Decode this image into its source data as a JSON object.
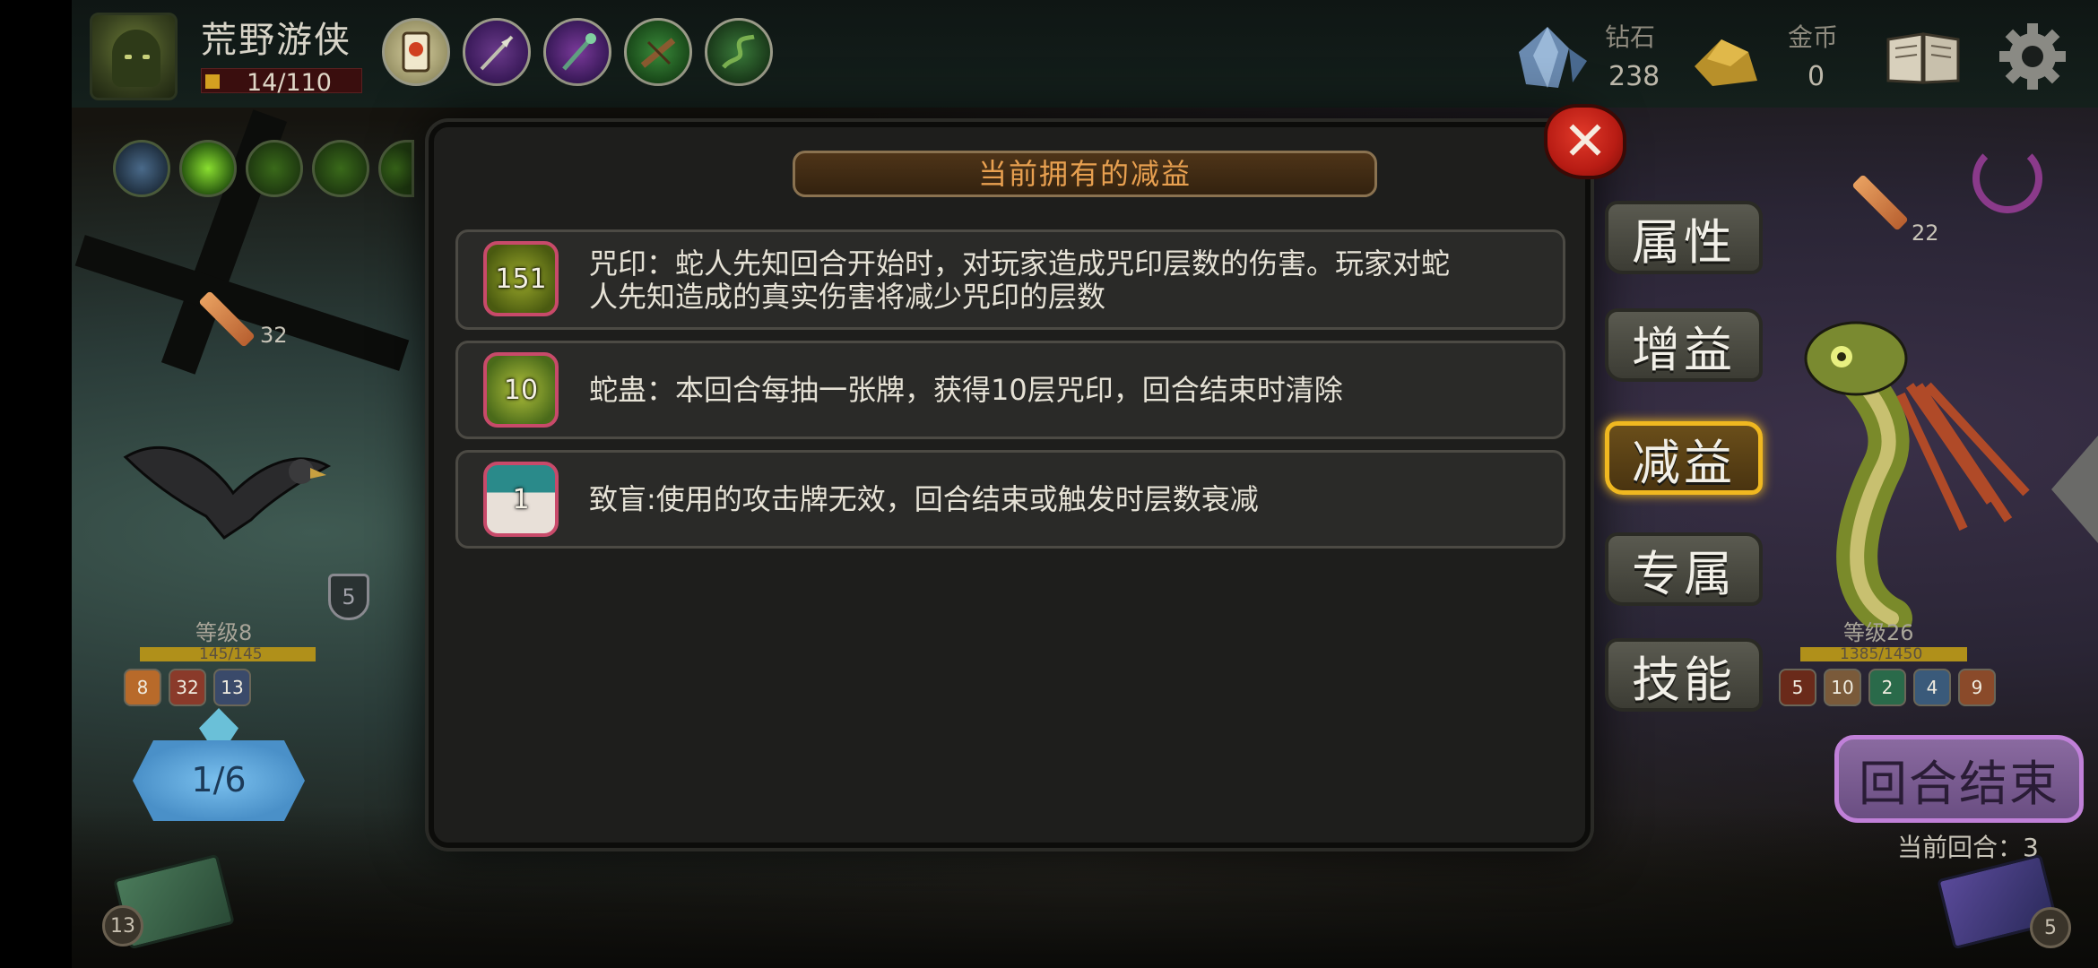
{
  "hero": {
    "name": "荒野游侠",
    "hp": "14/110"
  },
  "equipment": [
    "scroll-icon",
    "spear-icon",
    "staff-icon",
    "crossbow-icon",
    "vine-icon"
  ],
  "resources": {
    "diamond_label": "钻石",
    "diamond_value": "238",
    "gold_label": "金币",
    "gold_value": "0"
  },
  "player": {
    "attack": "32",
    "shield": "5",
    "level": "等级8",
    "hp": "145/145",
    "statuses": [
      "8",
      "32",
      "13"
    ],
    "energy": "1/6",
    "draw_pile": "13"
  },
  "modal": {
    "title": "当前拥有的减益",
    "debuffs": [
      {
        "name": "咒印",
        "stacks": "151",
        "text_line1": "咒印：蛇人先知回合开始时，对玩家造成咒印层数的伤害。玩家对蛇",
        "text_line2": "人先知造成的真实伤害将减少咒印的层数",
        "color": "#6a8a1a"
      },
      {
        "name": "蛇蛊",
        "stacks": "10",
        "text_line1": "蛇蛊：本回合每抽一张牌，获得10层咒印，回合结束时清除",
        "text_line2": "",
        "color": "#7a9a2a"
      },
      {
        "name": "致盲",
        "stacks": "1",
        "text_line1": "致盲:使用的攻击牌无效，回合结束或触发时层数衰减",
        "text_line2": "",
        "color": "#2a8a8a"
      }
    ]
  },
  "tabs": [
    {
      "label": "属性",
      "active": false
    },
    {
      "label": "增益",
      "active": false
    },
    {
      "label": "减益",
      "active": true
    },
    {
      "label": "专属",
      "active": false
    },
    {
      "label": "技能",
      "active": false
    }
  ],
  "enemy": {
    "attack": "22",
    "level": "等级26",
    "hp": "1385/1450",
    "statuses": [
      "5",
      "10",
      "2",
      "4",
      "9"
    ]
  },
  "end_turn_label": "回合结束",
  "current_turn": "当前回合：3",
  "discard_pile": "5",
  "colors": {
    "accent_orange": "#e8a050",
    "active_tab_border": "#f0b820",
    "debuff_border": "#c84a6a",
    "end_turn_purple": "#8a6aa0"
  }
}
